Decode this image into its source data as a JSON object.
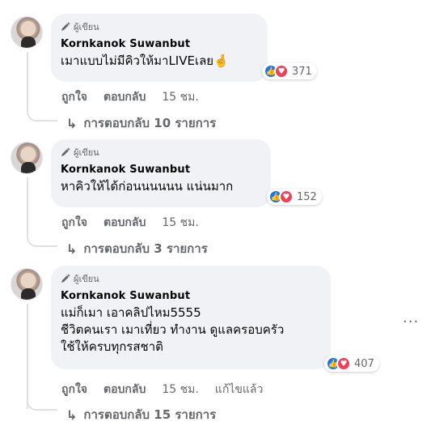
{
  "comments": [
    {
      "badge": "ผู้เขียน",
      "author": "Kornkanok Suwanbut",
      "text": "เมาแบบไม่มีคิวให้มาLIVEเลย🤞",
      "reaction_count": "371",
      "like_label": "ถูกใจ",
      "reply_label": "ตอบกลับ",
      "time": "15 ชม.",
      "replies_label": "การตอบกลับ 10 รายการ"
    },
    {
      "badge": "ผู้เขียน",
      "author": "Kornkanok Suwanbut",
      "text": "หาคิวให้ได้ก่อนนนนนน แน่นมาก",
      "reaction_count": "152",
      "like_label": "ถูกใจ",
      "reply_label": "ตอบกลับ",
      "time": "15 ชม.",
      "replies_label": "การตอบกลับ 3 รายการ"
    },
    {
      "badge": "ผู้เขียน",
      "author": "Kornkanok Suwanbut",
      "text": "แม่ก็เมา เอาคลิปไหม5555\nชีวิตคนเรา เมาเที่ยว ทำงาน ดูแลครอบครัว\nใช้ให้ครบทุกรสชาติ",
      "reaction_count": "407",
      "like_label": "ถูกใจ",
      "reply_label": "ตอบกลับ",
      "time": "15 ชม.",
      "edited_label": "แก้ไขแล้ว",
      "replies_label": "การตอบกลับ 15 รายการ",
      "more_label": "···"
    }
  ],
  "icons": {
    "like": "thumbs-up-icon",
    "love": "heart-icon",
    "author": "pen-icon",
    "reply": "reply-arrow-icon"
  },
  "colors": {
    "bubble": "#f0f2f5",
    "like": "#1877f2",
    "love": "#f33e58",
    "secondary_text": "#65676b"
  }
}
